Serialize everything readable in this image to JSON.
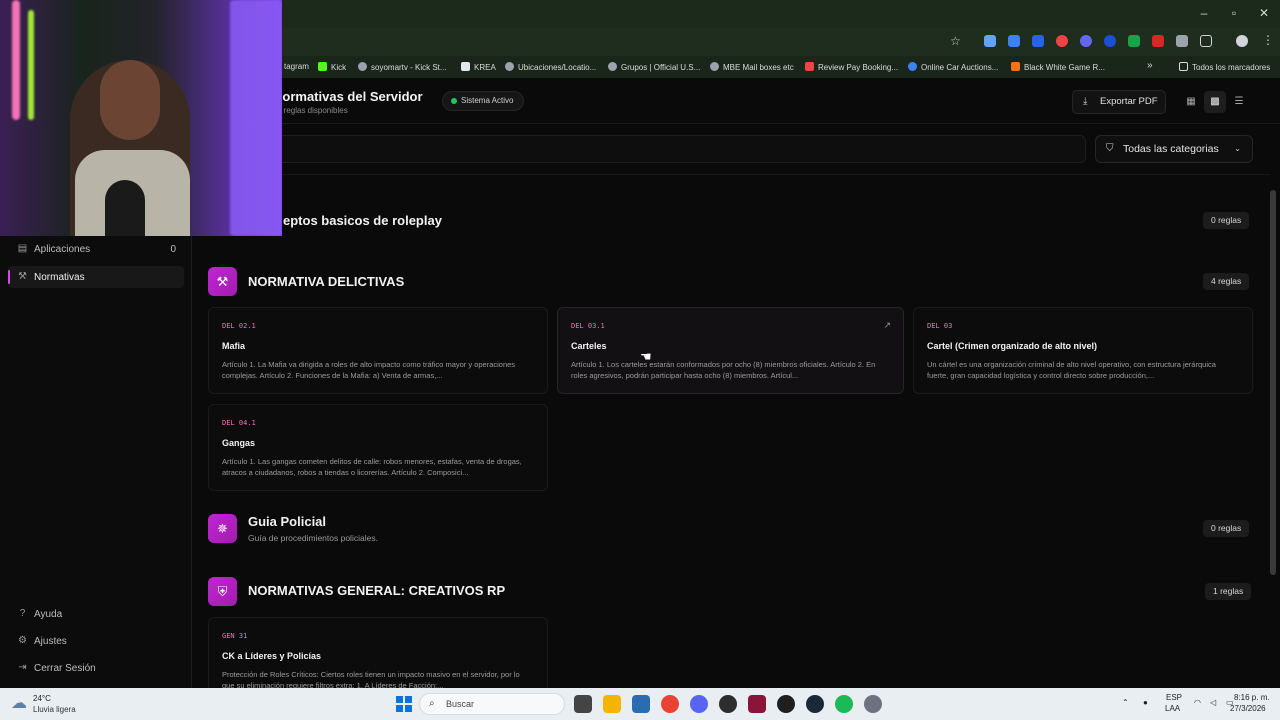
{
  "browser": {
    "window_controls": {
      "minimize": "–",
      "restore": "▫",
      "close": "✕"
    },
    "bookmarks": [
      {
        "label": "tagram",
        "color": "#d946ef"
      },
      {
        "label": "Kick",
        "color": "#53fc18"
      },
      {
        "label": "soyomartv - Kick St...",
        "color": "#9ca3af"
      },
      {
        "label": "KREA",
        "color": "#e5e7eb"
      },
      {
        "label": "Ubicaciones/Locatio...",
        "color": "#9ca3af"
      },
      {
        "label": "Grupos | Official U.S...",
        "color": "#9ca3af"
      },
      {
        "label": "MBE Mail boxes etc",
        "color": "#9ca3af"
      },
      {
        "label": "Review Pay Booking...",
        "color": "#ef4444"
      },
      {
        "label": "Online Car Auctions...",
        "color": "#3b82f6"
      },
      {
        "label": "Black White Game R...",
        "color": "#f97316"
      }
    ],
    "more_bookmarks": "»",
    "all_bookmarks": "Todos los marcadores"
  },
  "header": {
    "title": "Normativas del Servidor",
    "subtitle": "9 reglas disponibles",
    "status": "Sistema Activo",
    "export_label": "Exportar PDF"
  },
  "filters": {
    "category_label": "Todas las categorias"
  },
  "sidebar": {
    "items": [
      {
        "label": "Aplicaciones",
        "count": "0",
        "icon": "file-icon"
      },
      {
        "label": "Normativas",
        "icon": "gavel-icon"
      }
    ],
    "bottom": [
      {
        "label": "Ayuda",
        "icon": "help-icon"
      },
      {
        "label": "Ajustes",
        "icon": "gear-icon"
      },
      {
        "label": "Cerrar Sesión",
        "icon": "logout-icon"
      }
    ]
  },
  "sections": {
    "conceptos": {
      "title": "eptos basicos de roleplay",
      "count": "0 reglas"
    },
    "delictivas": {
      "title": "NORMATIVA DELICTIVAS",
      "count": "4 reglas",
      "cards": [
        {
          "code": "DEL 02.1",
          "title": "Mafia",
          "desc": "Artículo 1. La Mafia va dirigida a roles de alto impacto como tráfico mayor y operaciones complejas. Artículo 2. Funciones de la Mafia: a) Venta de armas,..."
        },
        {
          "code": "DEL 03.1",
          "title": "Carteles",
          "desc": "Artículo 1. Los carteles estarán conformados por ocho (8) miembros oficiales. Artículo 2. En roles agresivos, podrán participar hasta ocho (8) miembros. Artícul..."
        },
        {
          "code": "DEL 03",
          "title": "Cartel (Crimen organizado de alto nivel)",
          "desc": "Un cártel es una organización criminal de alto nivel operativo, con estructura jerárquica fuerte, gran capacidad logística y control directo sobre producción,..."
        },
        {
          "code": "DEL 04.1",
          "title": "Gangas",
          "desc": "Artículo 1. Las gangas cometen delitos de calle: robos menores, estafas, venta de drogas, atracos a ciudadanos, robos a tiendas o licorerías. Artículo 2. Composici..."
        }
      ]
    },
    "policial": {
      "title": "Guia Policial",
      "subtitle": "Guía de procedimientos policiales.",
      "count": "0 reglas"
    },
    "creativos": {
      "title": "NORMATIVAS GENERAL: CREATIVOS RP",
      "count": "1 reglas",
      "cards": [
        {
          "code": "GEN 31",
          "title": "CK a Líderes y Policías",
          "desc": "Protección de Roles Críticos: Ciertos roles tienen un impacto masivo en el servidor, por lo que su eliminación requiere filtros extra: 1. A Líderes de Facción:..."
        }
      ]
    }
  },
  "taskbar": {
    "temperature": "24°C",
    "weather": "Lluvia ligera",
    "search_label": "Buscar",
    "lang_top": "ESP",
    "lang_bottom": "LAA",
    "time": "8:16 p. m.",
    "date": "27/3/2026"
  }
}
